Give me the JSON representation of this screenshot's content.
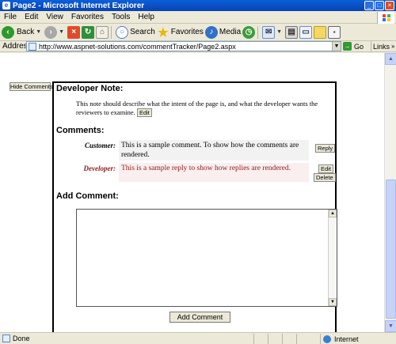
{
  "window": {
    "title": "Page2 - Microsoft Internet Explorer",
    "controls": [
      "_",
      "□",
      "×"
    ]
  },
  "menu": [
    "File",
    "Edit",
    "View",
    "Favorites",
    "Tools",
    "Help"
  ],
  "toolbar": {
    "back_label": "Back",
    "search_label": "Search",
    "favorites_label": "Favorites",
    "media_label": "Media"
  },
  "address": {
    "label": "Address",
    "url": "http://www.aspnet-solutions.com/commentTracker/Page2.aspx",
    "go_label": "Go",
    "links_label": "Links"
  },
  "page": {
    "hide_comments_label": "Hide Comments",
    "developer_note_heading": "Developer Note:",
    "developer_note_text": "This note should describe what the intent of the page is, and what the developer wants the reviewers to examine.",
    "edit_label": "Edit",
    "comments_heading": "Comments:",
    "comments": [
      {
        "author": "Customer:",
        "text": "This is a sample comment. To show how the comments are rendered.",
        "action": "Reply"
      },
      {
        "author": "Developer:",
        "text": "This is a sample reply to show how replies are rendered.",
        "action_edit": "Edit",
        "action_delete": "Delete"
      }
    ],
    "add_comment_heading": "Add Comment:",
    "add_comment_button": "Add Comment"
  },
  "status": {
    "left": "Done",
    "zone": "Internet"
  },
  "colors": {
    "developer_text": "#8b1a1a",
    "customer_bg": "#f2f2f2",
    "developer_bg": "#fbeeee",
    "titlebar": "#0a5fd8"
  }
}
